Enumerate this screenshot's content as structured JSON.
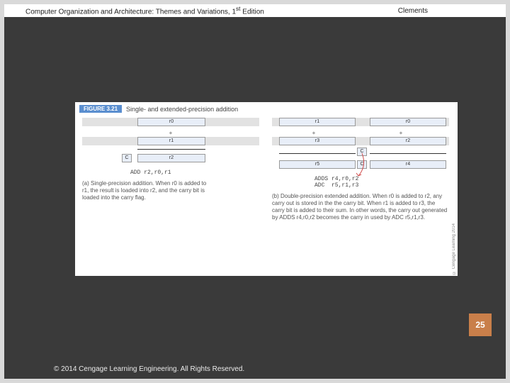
{
  "header": {
    "title_prefix": "Computer Organization and Architecture: Themes and Variations, 1",
    "title_sup": "st",
    "title_suffix": " Edition",
    "author": "Clements"
  },
  "figure": {
    "label": "FIGURE 3.21",
    "caption": "Single- and extended-precision addition",
    "left": {
      "r0": "r0",
      "r1": "r1",
      "r2": "r2",
      "c": "C",
      "plus": "+",
      "asm": "ADD r2,r0,r1",
      "sub": "(a) Single-precision addition. When r0 is added to r1, the result is loaded into r2, and the carry bit is loaded into the carry flag."
    },
    "right": {
      "r0": "r0",
      "r1": "r1",
      "r2": "r2",
      "r3": "r3",
      "r4": "r4",
      "r5": "r5",
      "c": "C",
      "plus": "+",
      "asm": "ADDS r4,r0,r2\nADC  r5,r1,r3",
      "sub": "(b) Double-precision extended addition. When r0 is added to r2, any carry out is stored in the the carry bit. When r1 is added to r3, the carry bit is added to their sum. In other words, the carry out generated by  ADDS r4,r0,r2  becomes the carry in used by ADC  r5,r1,r3."
    },
    "vcopy": "© Cengage Learning 2014"
  },
  "page_number": "25",
  "footer": "© 2014 Cengage Learning Engineering. All Rights Reserved."
}
